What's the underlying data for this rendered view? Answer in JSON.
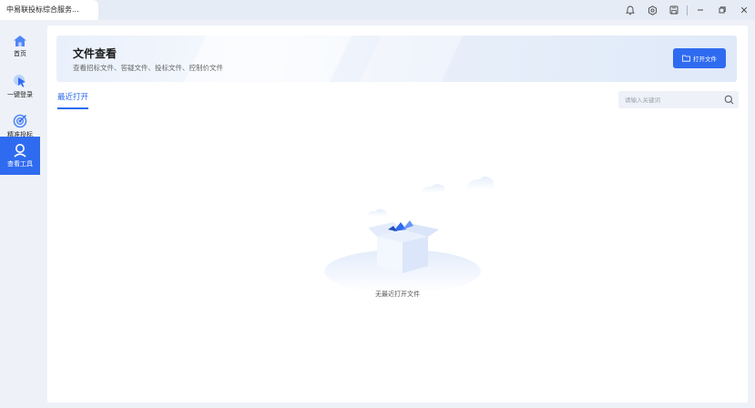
{
  "titlebar": {
    "tab_title": "中易联投标综合服务..."
  },
  "sidebar": {
    "items": [
      {
        "label": "首页",
        "icon": "home-icon",
        "active": false
      },
      {
        "label": "一键登录",
        "icon": "cursor-icon",
        "active": false
      },
      {
        "label": "精准投标",
        "icon": "target-icon",
        "active": false
      },
      {
        "label": "查看工具",
        "icon": "search-person-icon",
        "active": true
      }
    ]
  },
  "banner": {
    "title": "文件查看",
    "subtitle": "查看招标文件、答疑文件、投标文件、控制价文件",
    "open_button": "打开文件"
  },
  "tabs": {
    "recent": "最近打开"
  },
  "search": {
    "placeholder": "请输入关键词"
  },
  "empty": {
    "text": "无最近打开文件"
  },
  "colors": {
    "accent": "#2f6bf0",
    "background": "#eef2f8"
  }
}
